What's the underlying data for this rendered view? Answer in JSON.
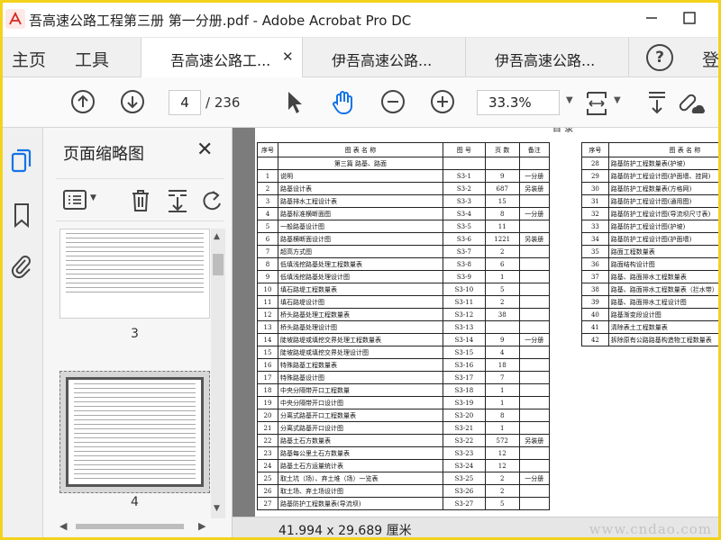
{
  "window": {
    "title": "吾高速公路工程第三册  第一分册.pdf - Adobe Acrobat Pro DC",
    "minimize_label": "—",
    "maximize_label": "☐"
  },
  "nav": {
    "home": "主页",
    "tools": "工具",
    "tabs": [
      {
        "label": "吾高速公路工...",
        "active": true
      },
      {
        "label": "伊吾高速公路...",
        "active": false
      },
      {
        "label": "伊吾高速公路...",
        "active": false
      }
    ],
    "help": "?",
    "login_stub": "登"
  },
  "toolbar": {
    "current_page": "4",
    "total_pages": "/ 236",
    "zoom": "33.3%"
  },
  "thumbnails": {
    "title": "页面缩略图",
    "pages": [
      "3",
      "4"
    ]
  },
  "document": {
    "heading_stub": "目 录",
    "dimensions": "41.994 x 29.689 厘米",
    "watermark": "www.cndao.com",
    "left_headers": [
      "序号",
      "图 表 名 称",
      "图 号",
      "页 数",
      "备注"
    ],
    "section_title": "第三篇  路基、路面",
    "left_rows": [
      [
        "1",
        "说明",
        "S3-1",
        "9",
        "一分册"
      ],
      [
        "2",
        "路基设计表",
        "S3-2",
        "687",
        "另装册"
      ],
      [
        "3",
        "路基排水工程设计表",
        "S3-3",
        "15",
        ""
      ],
      [
        "4",
        "路基标准横断面图",
        "S3-4",
        "8",
        "一分册"
      ],
      [
        "5",
        "一般路基设计图",
        "S3-5",
        "11",
        ""
      ],
      [
        "6",
        "路基横断面设计图",
        "S3-6",
        "1221",
        "另装册"
      ],
      [
        "7",
        "超高方式图",
        "S3-7",
        "2",
        ""
      ],
      [
        "8",
        "低填浅挖路基处理工程数量表",
        "S3-8",
        "6",
        ""
      ],
      [
        "9",
        "低填浅挖路基处理设计图",
        "S3-9",
        "1",
        ""
      ],
      [
        "10",
        "填石路堤工程数量表",
        "S3-10",
        "5",
        ""
      ],
      [
        "11",
        "填石路堤设计图",
        "S3-11",
        "2",
        ""
      ],
      [
        "12",
        "桥头路基处理工程数量表",
        "S3-12",
        "38",
        ""
      ],
      [
        "13",
        "桥头路基处理设计图",
        "S3-13",
        "",
        ""
      ],
      [
        "14",
        "陡坡路堤或填挖交界处理工程数量表",
        "S3-14",
        "9",
        "一分册"
      ],
      [
        "15",
        "陡坡路堤或填挖交界处理设计图",
        "S3-15",
        "4",
        ""
      ],
      [
        "16",
        "特殊路基工程数量表",
        "S3-16",
        "18",
        ""
      ],
      [
        "17",
        "特殊路基设计图",
        "S3-17",
        "7",
        ""
      ],
      [
        "18",
        "中央分隔带开口工程数量",
        "S3-18",
        "1",
        ""
      ],
      [
        "19",
        "中央分隔带开口设计图",
        "S3-19",
        "1",
        ""
      ],
      [
        "20",
        "分离式路基开口工程数量表",
        "S3-20",
        "8",
        ""
      ],
      [
        "21",
        "分离式路基开口设计图",
        "S3-21",
        "1",
        ""
      ],
      [
        "22",
        "路基土石方数量表",
        "S3-22",
        "572",
        "另装册"
      ],
      [
        "23",
        "路基每公里土石方数量表",
        "S3-23",
        "12",
        ""
      ],
      [
        "24",
        "路基土石方运量统计表",
        "S3-24",
        "12",
        ""
      ],
      [
        "25",
        "取土坑（场）、弃土堆（场）一览表",
        "S3-25",
        "2",
        "一分册"
      ],
      [
        "26",
        "取土场、弃土场设计图",
        "S3-26",
        "2",
        ""
      ],
      [
        "27",
        "路基防护工程数量表(导流坝)",
        "S3-27",
        "5",
        ""
      ]
    ],
    "right_headers": [
      "序号",
      "图 表 名 称"
    ],
    "right_rows": [
      [
        "28",
        "路基防护工程数量表(护坡)"
      ],
      [
        "29",
        "路基防护工程设计图(护面墙、挂网)"
      ],
      [
        "30",
        "路基防护工程数量表(方格网)"
      ],
      [
        "31",
        "路基防护工程设计图(通用图)"
      ],
      [
        "32",
        "路基防护工程设计图(导流坝尺寸表)"
      ],
      [
        "33",
        "路基防护工程设计图(护坡)"
      ],
      [
        "34",
        "路基防护工程设计图(护面墙)"
      ],
      [
        "35",
        "路面工程数量表"
      ],
      [
        "36",
        "路面结构设计图"
      ],
      [
        "37",
        "路基、路面排水工程数量表"
      ],
      [
        "38",
        "路基、路面排水工程数量表（拦水带）"
      ],
      [
        "39",
        "路基、路面排水工程设计图"
      ],
      [
        "40",
        "路基渐变段设计图"
      ],
      [
        "41",
        "清除表土工程数量表"
      ],
      [
        "42",
        "拆除原有公路路基构造物工程数量表"
      ]
    ]
  }
}
